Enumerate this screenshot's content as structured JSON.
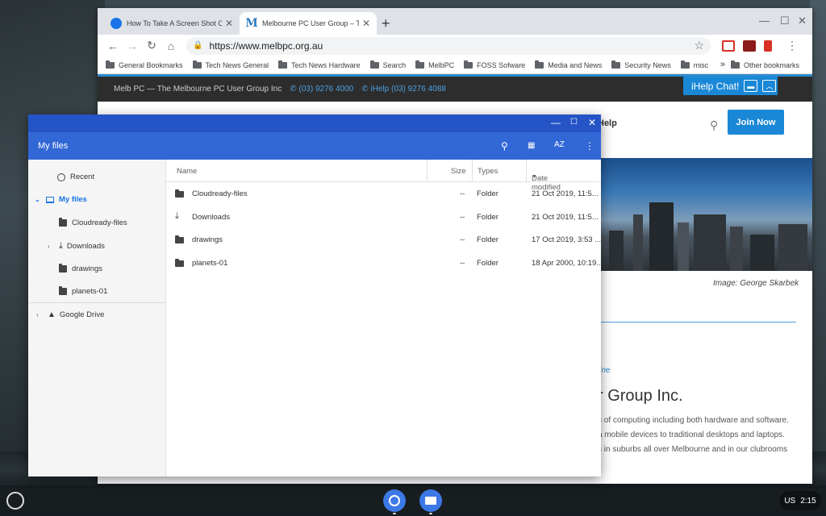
{
  "browser": {
    "tabs": [
      {
        "title": "How To Take A Screen Shot On C",
        "favicon": "chromebook-help-icon"
      },
      {
        "title": "Melbourne PC User Group – The",
        "favicon": "M",
        "active": true
      }
    ],
    "url_prefix": "https://",
    "url_host": "www.melbpc.org.au",
    "bookmarks": [
      "General Bookmarks",
      "Tech News General",
      "Tech News Hardware",
      "Search",
      "MelbPC",
      "FOSS Sofware",
      "Media and News",
      "Security News",
      "misc"
    ],
    "bookmarks_more": "»",
    "other_bookmarks": "Other bookmarks"
  },
  "site": {
    "header_text": "Melb PC — The Melbourne PC User Group Inc",
    "phone": "(03) 9276 4000",
    "ihelp_phone": "iHelp (03) 9276 4088",
    "ihelp_chat": "iHelp Chat!",
    "nav_help": "Help",
    "join_button": "Join Now",
    "image_caption": "Image:  George Skarbek",
    "online_link": "line",
    "title_fragment": "r Group Inc.",
    "body_lines": [
      "s of computing including both hardware and software.",
      "a mobile devices to traditional desktops and laptops.",
      "s in suburbs all over Melbourne and in our clubrooms"
    ],
    "accent_color": "#1a88d6"
  },
  "files": {
    "title": "My files",
    "sort_label": "AZ",
    "sidebar": [
      {
        "label": "Recent",
        "icon": "clock-icon"
      },
      {
        "label": "My files",
        "icon": "laptop-icon",
        "active": true
      },
      {
        "label": "Cloudready-files",
        "icon": "folder-icon"
      },
      {
        "label": "Downloads",
        "icon": "download-icon"
      },
      {
        "label": "drawings",
        "icon": "folder-icon"
      },
      {
        "label": "planets-01",
        "icon": "folder-icon"
      },
      {
        "label": "Google Drive",
        "icon": "google-drive-icon"
      }
    ],
    "columns": {
      "name": "Name",
      "size": "Size",
      "type": "Types",
      "date": "Date modified"
    },
    "rows": [
      {
        "name": "Cloudready-files",
        "size": "--",
        "type": "Folder",
        "date": "21 Oct 2019, 11:5..."
      },
      {
        "name": "Downloads",
        "size": "--",
        "type": "Folder",
        "date": "21 Oct 2019, 11:5..."
      },
      {
        "name": "drawings",
        "size": "--",
        "type": "Folder",
        "date": "17 Oct 2019, 3:53 ..."
      },
      {
        "name": "planets-01",
        "size": "--",
        "type": "Folder",
        "date": "18 Apr 2000, 10:19..."
      }
    ],
    "primary_color": "#3267d6"
  },
  "shelf": {
    "locale": "US",
    "time": "2:15"
  }
}
